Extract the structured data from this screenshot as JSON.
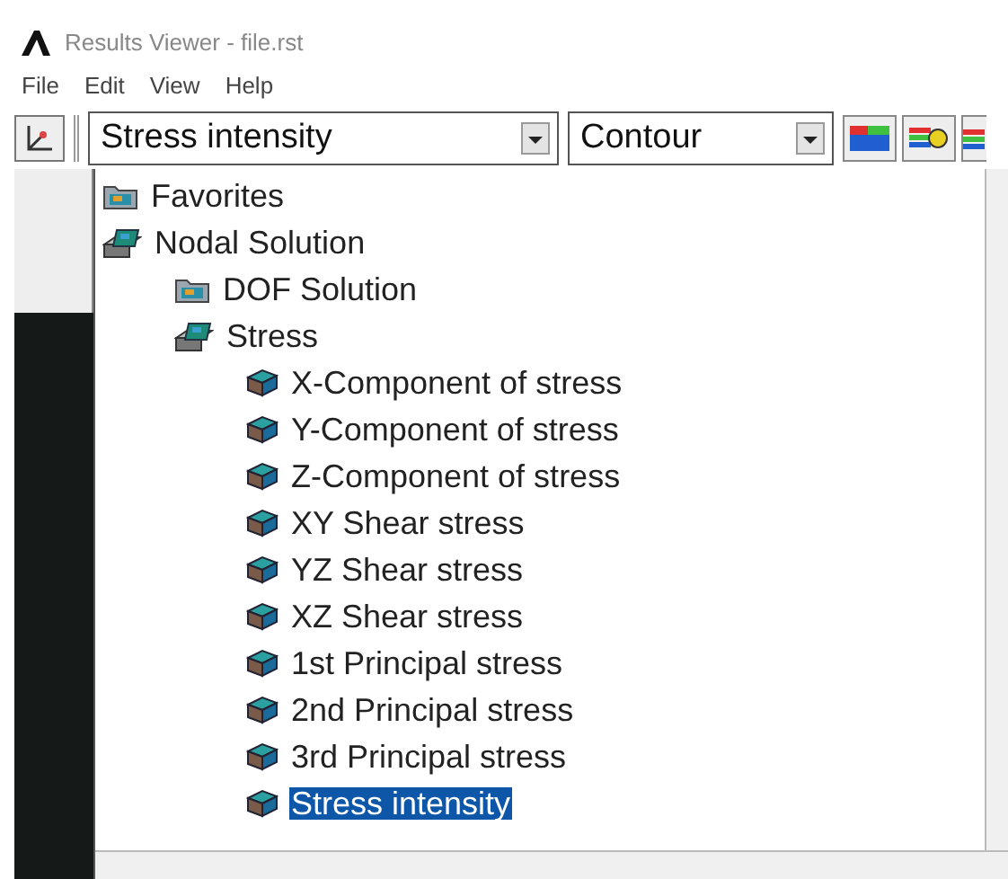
{
  "window": {
    "title": "Results Viewer - file.rst"
  },
  "menu": [
    "File",
    "Edit",
    "View",
    "Help"
  ],
  "toolbar": {
    "result_select": {
      "value": "Stress intensity"
    },
    "plot_select": {
      "value": "Contour"
    }
  },
  "tree": [
    {
      "label": "Favorites",
      "kind": "folder",
      "selected": false
    },
    {
      "label": "Nodal Solution",
      "kind": "group",
      "selected": false,
      "children": [
        {
          "label": "DOF Solution",
          "kind": "folder",
          "selected": false
        },
        {
          "label": "Stress",
          "kind": "group",
          "selected": false,
          "children": [
            {
              "label": "X-Component of stress",
              "kind": "result",
              "selected": false
            },
            {
              "label": "Y-Component of stress",
              "kind": "result",
              "selected": false
            },
            {
              "label": "Z-Component of stress",
              "kind": "result",
              "selected": false
            },
            {
              "label": "XY Shear stress",
              "kind": "result",
              "selected": false
            },
            {
              "label": "YZ Shear stress",
              "kind": "result",
              "selected": false
            },
            {
              "label": "XZ Shear stress",
              "kind": "result",
              "selected": false
            },
            {
              "label": "1st Principal stress",
              "kind": "result",
              "selected": false
            },
            {
              "label": "2nd Principal stress",
              "kind": "result",
              "selected": false
            },
            {
              "label": "3rd Principal stress",
              "kind": "result",
              "selected": false
            },
            {
              "label": "Stress intensity",
              "kind": "result",
              "selected": true
            }
          ]
        }
      ]
    }
  ]
}
